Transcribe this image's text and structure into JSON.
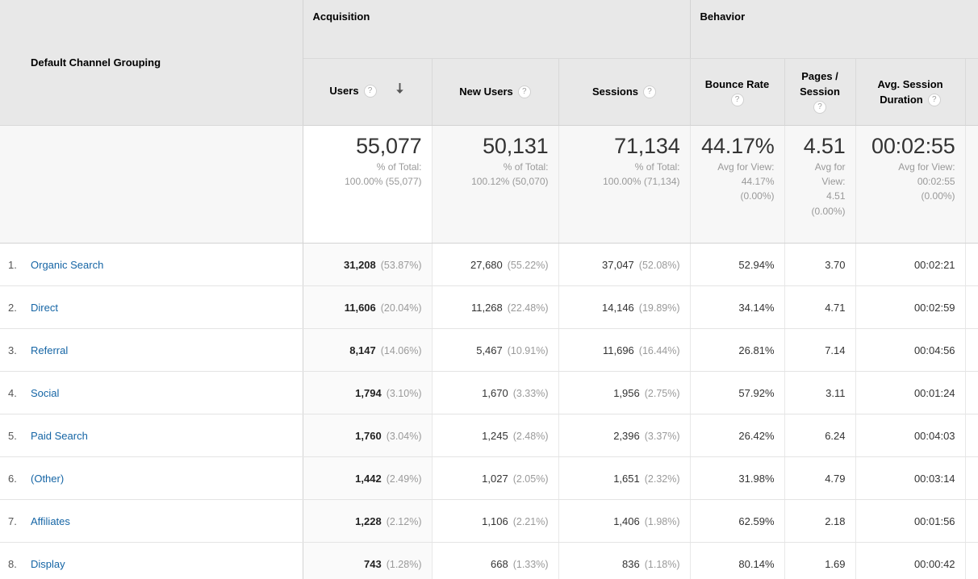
{
  "table": {
    "dimension_header": "Default Channel Grouping",
    "groups": [
      {
        "label": "Acquisition"
      },
      {
        "label": "Behavior"
      }
    ],
    "metrics": [
      {
        "label": "Users",
        "help": "?",
        "sorted": true,
        "sort_dir": "desc"
      },
      {
        "label": "New Users",
        "help": "?"
      },
      {
        "label": "Sessions",
        "help": "?"
      },
      {
        "label": "Bounce Rate",
        "help": "?"
      },
      {
        "label_line1": "Pages /",
        "label_line2": "Session",
        "help": "?"
      },
      {
        "label_line1": "Avg. Session",
        "label_line2": "Duration",
        "help": "?"
      }
    ],
    "totals": {
      "users": {
        "value": "55,077",
        "sub1": "% of Total:",
        "sub2": "100.00% (55,077)"
      },
      "new_users": {
        "value": "50,131",
        "sub1": "% of Total:",
        "sub2": "100.12% (50,070)"
      },
      "sessions": {
        "value": "71,134",
        "sub1": "% of Total:",
        "sub2": "100.00% (71,134)"
      },
      "bounce_rate": {
        "value": "44.17%",
        "sub1": "Avg for View:",
        "sub2": "44.17%",
        "sub3": "(0.00%)"
      },
      "pages_session": {
        "value": "4.51",
        "sub1": "Avg for",
        "sub2": "View:",
        "sub3": "4.51",
        "sub4": "(0.00%)"
      },
      "avg_duration": {
        "value": "00:02:55",
        "sub1": "Avg for View:",
        "sub2": "00:02:55",
        "sub3": "(0.00%)"
      }
    },
    "rows": [
      {
        "index": "1.",
        "channel": "Organic Search",
        "users": "31,208",
        "users_pct": "(53.87%)",
        "new_users": "27,680",
        "new_users_pct": "(55.22%)",
        "sessions": "37,047",
        "sessions_pct": "(52.08%)",
        "bounce_rate": "52.94%",
        "pages_session": "3.70",
        "avg_duration": "00:02:21"
      },
      {
        "index": "2.",
        "channel": "Direct",
        "users": "11,606",
        "users_pct": "(20.04%)",
        "new_users": "11,268",
        "new_users_pct": "(22.48%)",
        "sessions": "14,146",
        "sessions_pct": "(19.89%)",
        "bounce_rate": "34.14%",
        "pages_session": "4.71",
        "avg_duration": "00:02:59"
      },
      {
        "index": "3.",
        "channel": "Referral",
        "users": "8,147",
        "users_pct": "(14.06%)",
        "new_users": "5,467",
        "new_users_pct": "(10.91%)",
        "sessions": "11,696",
        "sessions_pct": "(16.44%)",
        "bounce_rate": "26.81%",
        "pages_session": "7.14",
        "avg_duration": "00:04:56"
      },
      {
        "index": "4.",
        "channel": "Social",
        "users": "1,794",
        "users_pct": "(3.10%)",
        "new_users": "1,670",
        "new_users_pct": "(3.33%)",
        "sessions": "1,956",
        "sessions_pct": "(2.75%)",
        "bounce_rate": "57.92%",
        "pages_session": "3.11",
        "avg_duration": "00:01:24"
      },
      {
        "index": "5.",
        "channel": "Paid Search",
        "users": "1,760",
        "users_pct": "(3.04%)",
        "new_users": "1,245",
        "new_users_pct": "(2.48%)",
        "sessions": "2,396",
        "sessions_pct": "(3.37%)",
        "bounce_rate": "26.42%",
        "pages_session": "6.24",
        "avg_duration": "00:04:03"
      },
      {
        "index": "6.",
        "channel": "(Other)",
        "users": "1,442",
        "users_pct": "(2.49%)",
        "new_users": "1,027",
        "new_users_pct": "(2.05%)",
        "sessions": "1,651",
        "sessions_pct": "(2.32%)",
        "bounce_rate": "31.98%",
        "pages_session": "4.79",
        "avg_duration": "00:03:14"
      },
      {
        "index": "7.",
        "channel": "Affiliates",
        "users": "1,228",
        "users_pct": "(2.12%)",
        "new_users": "1,106",
        "new_users_pct": "(2.21%)",
        "sessions": "1,406",
        "sessions_pct": "(1.98%)",
        "bounce_rate": "62.59%",
        "pages_session": "2.18",
        "avg_duration": "00:01:56"
      },
      {
        "index": "8.",
        "channel": "Display",
        "users": "743",
        "users_pct": "(1.28%)",
        "new_users": "668",
        "new_users_pct": "(1.33%)",
        "sessions": "836",
        "sessions_pct": "(1.18%)",
        "bounce_rate": "80.14%",
        "pages_session": "1.69",
        "avg_duration": "00:00:42"
      }
    ]
  },
  "colors": {
    "link": "#1565a5",
    "header_bg": "#e8e8e8",
    "total_bg": "#f7f7f7",
    "users_col_bg": "#fafafa",
    "muted": "#9a9a9a"
  }
}
